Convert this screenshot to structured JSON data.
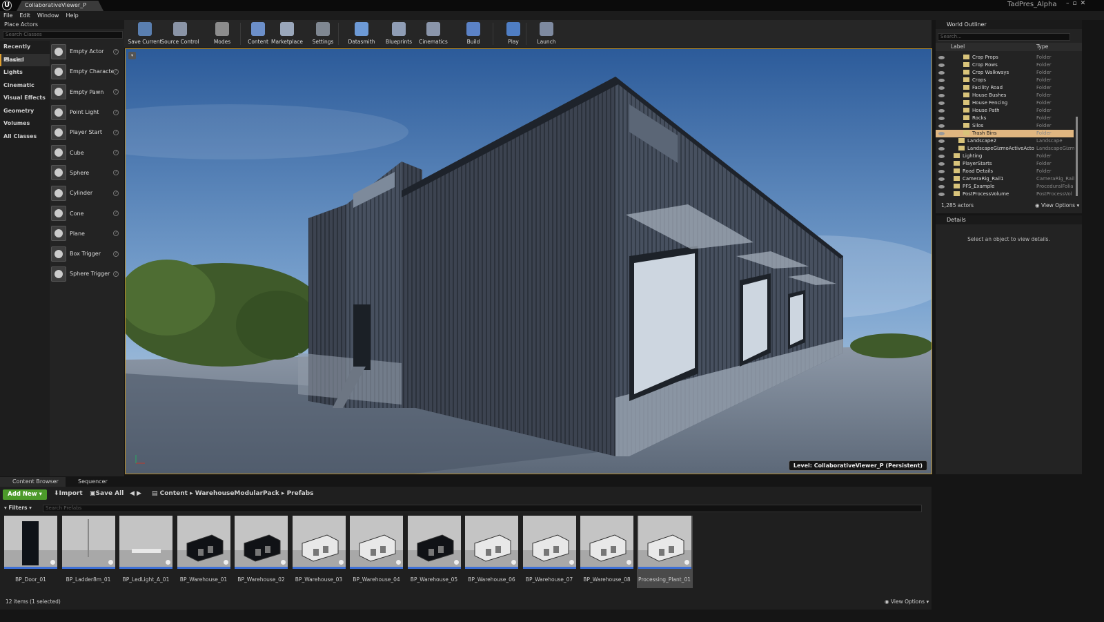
{
  "window": {
    "tab": "CollaborativeViewer_P",
    "project": "TadPres_Alpha"
  },
  "menu": [
    "File",
    "Edit",
    "Window",
    "Help"
  ],
  "place_actors": {
    "title": "Place Actors",
    "search_placeholder": "Search Classes",
    "categories": [
      "Recently Placed",
      "Basic",
      "Lights",
      "Cinematic",
      "Visual Effects",
      "Geometry",
      "Volumes",
      "All Classes"
    ],
    "selected_category": "Basic",
    "items": [
      "Empty Actor",
      "Empty Characte",
      "Empty Pawn",
      "Point Light",
      "Player Start",
      "Cube",
      "Sphere",
      "Cylinder",
      "Cone",
      "Plane",
      "Box Trigger",
      "Sphere Trigger"
    ]
  },
  "toolbar": {
    "buttons": [
      "Save Current",
      "Source Control",
      "Modes",
      "Content",
      "Marketplace",
      "Settings",
      "Datasmith",
      "Blueprints",
      "Cinematics",
      "Build",
      "Play",
      "Launch"
    ]
  },
  "viewport": {
    "level": "Level:  CollaborativeViewer_P (Persistent)"
  },
  "outliner": {
    "title": "World Outliner",
    "search_placeholder": "Search...",
    "col_label": "Label",
    "col_type": "Type",
    "rows": [
      {
        "label": "Crop Props",
        "type": "Folder",
        "indent": 2
      },
      {
        "label": "Crop Rows",
        "type": "Folder",
        "indent": 2
      },
      {
        "label": "Crop Walkways",
        "type": "Folder",
        "indent": 2
      },
      {
        "label": "Crops",
        "type": "Folder",
        "indent": 2
      },
      {
        "label": "Facility Road",
        "type": "Folder",
        "indent": 2
      },
      {
        "label": "House Bushes",
        "type": "Folder",
        "indent": 2
      },
      {
        "label": "House Fencing",
        "type": "Folder",
        "indent": 2
      },
      {
        "label": "House Path",
        "type": "Folder",
        "indent": 2
      },
      {
        "label": "Rocks",
        "type": "Folder",
        "indent": 2
      },
      {
        "label": "Silos",
        "type": "Folder",
        "indent": 2
      },
      {
        "label": "Trash Bins",
        "type": "Folder",
        "indent": 2,
        "selected": true
      },
      {
        "label": "Landscape2",
        "type": "Landscape",
        "indent": 1
      },
      {
        "label": "LandscapeGizmoActiveActo",
        "type": "LandscapeGizm",
        "indent": 1
      },
      {
        "label": "Lighting",
        "type": "Folder",
        "indent": 0
      },
      {
        "label": "PlayerStarts",
        "type": "Folder",
        "indent": 0
      },
      {
        "label": "Road Details",
        "type": "Folder",
        "indent": 0
      },
      {
        "label": "CameraRig_Rail1",
        "type": "CameraRig_Rail",
        "indent": 0
      },
      {
        "label": "PFS_Example",
        "type": "ProceduralFolia",
        "indent": 0
      },
      {
        "label": "PostProcessVolume",
        "type": "PostProcessVol",
        "indent": 0
      }
    ],
    "count": "1,285 actors",
    "view_options": "View Options"
  },
  "details": {
    "title": "Details",
    "empty": "Select an object to view details."
  },
  "content_browser": {
    "tabs": [
      "Content Browser",
      "Sequencer"
    ],
    "add_new": "Add New",
    "import": "Import",
    "save_all": "Save All",
    "path": [
      "Content",
      "WarehouseModularPack",
      "Prefabs"
    ],
    "filters": "Filters",
    "search_placeholder": "Search Prefabs",
    "assets": [
      "BP_Door_01",
      "BP_Ladder8m_01",
      "BP_LedLight_A_01",
      "BP_Warehouse_01",
      "BP_Warehouse_02",
      "BP_Warehouse_03",
      "BP_Warehouse_04",
      "BP_Warehouse_05",
      "BP_Warehouse_06",
      "BP_Warehouse_07",
      "BP_Warehouse_08",
      "Processing_Plant_01"
    ],
    "selected_asset": "Processing_Plant_01",
    "status": "12 items (1 selected)",
    "view_options": "View Options"
  }
}
